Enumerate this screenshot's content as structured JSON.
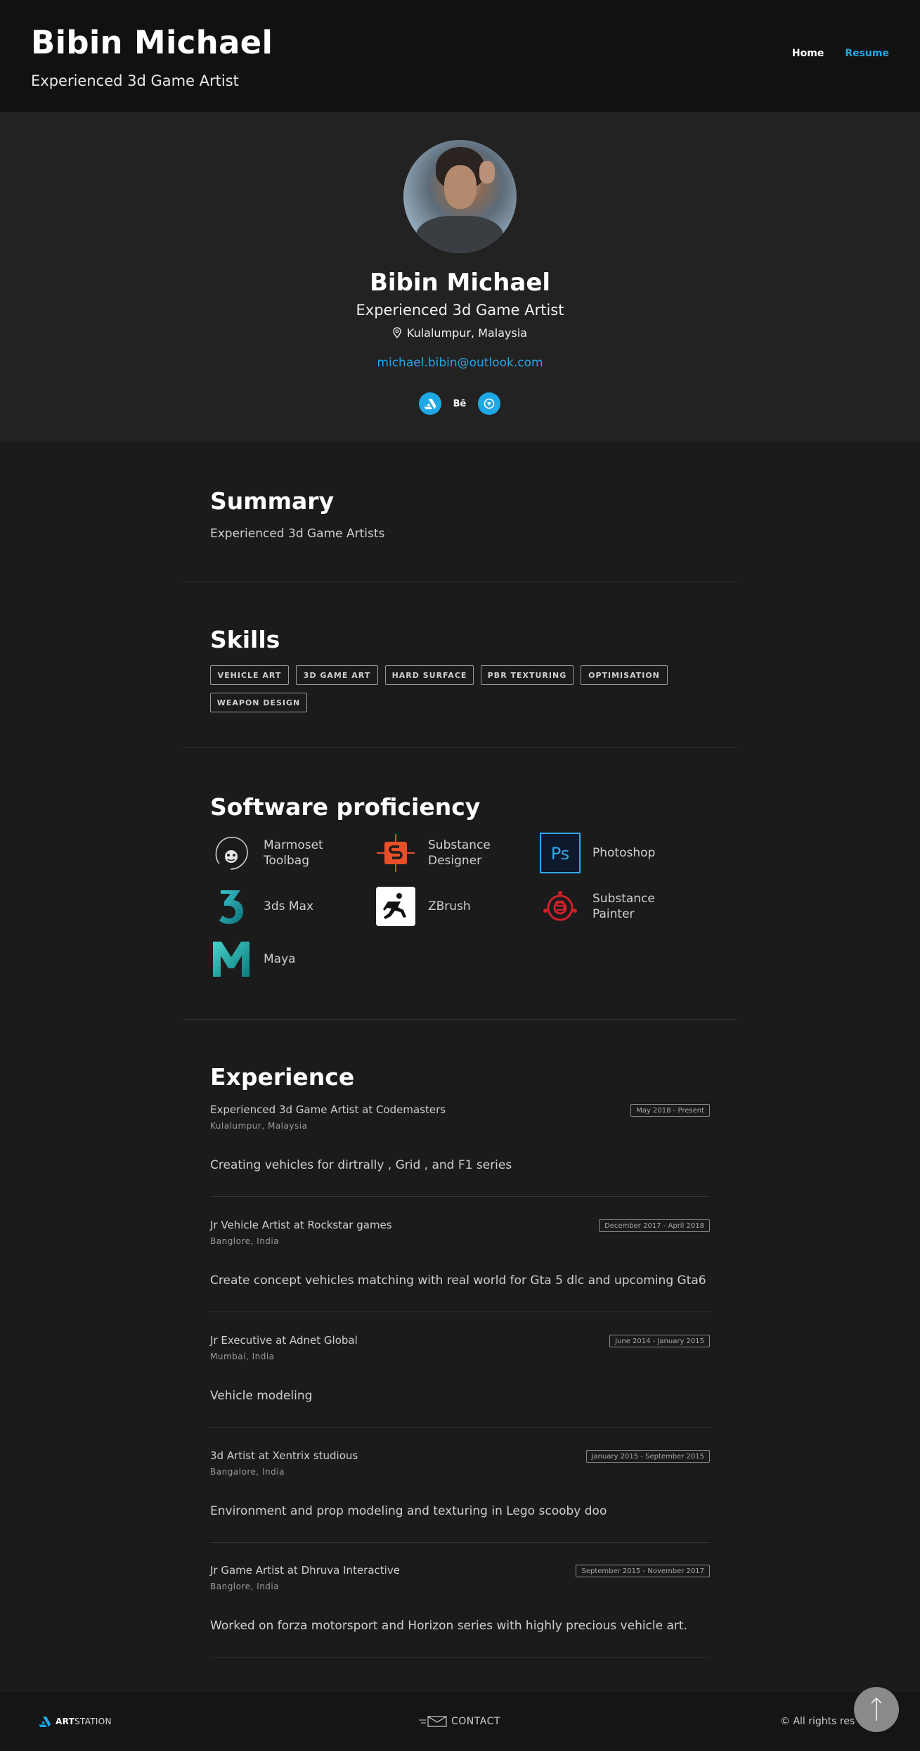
{
  "header": {
    "title": "Bibin Michael",
    "subtitle": "Experienced 3d Game Artist",
    "nav": [
      {
        "label": "Home",
        "active": false
      },
      {
        "label": "Resume",
        "active": true
      }
    ]
  },
  "profile": {
    "name": "Bibin Michael",
    "headline": "Experienced 3d Game Artist",
    "location": "Kulalumpur, Malaysia",
    "email": "michael.bibin@outlook.com",
    "socials": [
      {
        "icon": "artstation-icon"
      },
      {
        "icon": "behance-icon",
        "text": "Bē"
      },
      {
        "icon": "third-social-icon"
      }
    ]
  },
  "summary": {
    "title": "Summary",
    "text": "Experienced 3d Game Artists"
  },
  "skills": {
    "title": "Skills",
    "items": [
      "VEHICLE ART",
      "3D GAME ART",
      "HARD SURFACE",
      "PBR TEXTURING",
      "OPTIMISATION",
      "WEAPON DESIGN"
    ]
  },
  "software": {
    "title": "Software proficiency",
    "items": [
      {
        "name": "Marmoset Toolbag",
        "icon": "marmoset-icon"
      },
      {
        "name": "Substance Designer",
        "icon": "substance-designer-icon"
      },
      {
        "name": "Photoshop",
        "icon": "photoshop-icon"
      },
      {
        "name": "3ds Max",
        "icon": "3dsmax-icon"
      },
      {
        "name": "ZBrush",
        "icon": "zbrush-icon"
      },
      {
        "name": "Substance Painter",
        "icon": "substance-painter-icon"
      },
      {
        "name": "Maya",
        "icon": "maya-icon"
      }
    ]
  },
  "experience": {
    "title": "Experience",
    "items": [
      {
        "role": "Experienced 3d Game Artist at Codemasters",
        "place": "Kulalumpur, Malaysia",
        "dates": "May 2018 - Present",
        "desc": "Creating vehicles for dirtrally , Grid , and F1 series"
      },
      {
        "role": "Jr Vehicle Artist at Rockstar games",
        "place": "Banglore, India",
        "dates": "December 2017 - April 2018",
        "desc": "Create concept vehicles matching with real world for Gta 5 dlc and upcoming Gta6"
      },
      {
        "role": "Jr Executive at Adnet Global",
        "place": "Mumbai, India",
        "dates": "June 2014 - January 2015",
        "desc": "Vehicle modeling"
      },
      {
        "role": "3d Artist at Xentrix studious",
        "place": "Bangalore, India",
        "dates": "January 2015 - September 2015",
        "desc": "Environment and prop modeling and texturing in Lego scooby doo"
      },
      {
        "role": "Jr Game Artist at Dhruva Interactive",
        "place": "Banglore, India",
        "dates": "September 2015 - November 2017",
        "desc": "Worked on forza motorsport and Horizon series with highly precious vehicle art."
      }
    ]
  },
  "footer": {
    "brand_bold": "ART",
    "brand_rest": "STATION",
    "contact": "CONTACT",
    "rights": "© All rights res"
  },
  "colors": {
    "accent": "#1fa8e6",
    "background": "#1b1b1b",
    "header": "#111111",
    "profile_band": "#222222"
  }
}
